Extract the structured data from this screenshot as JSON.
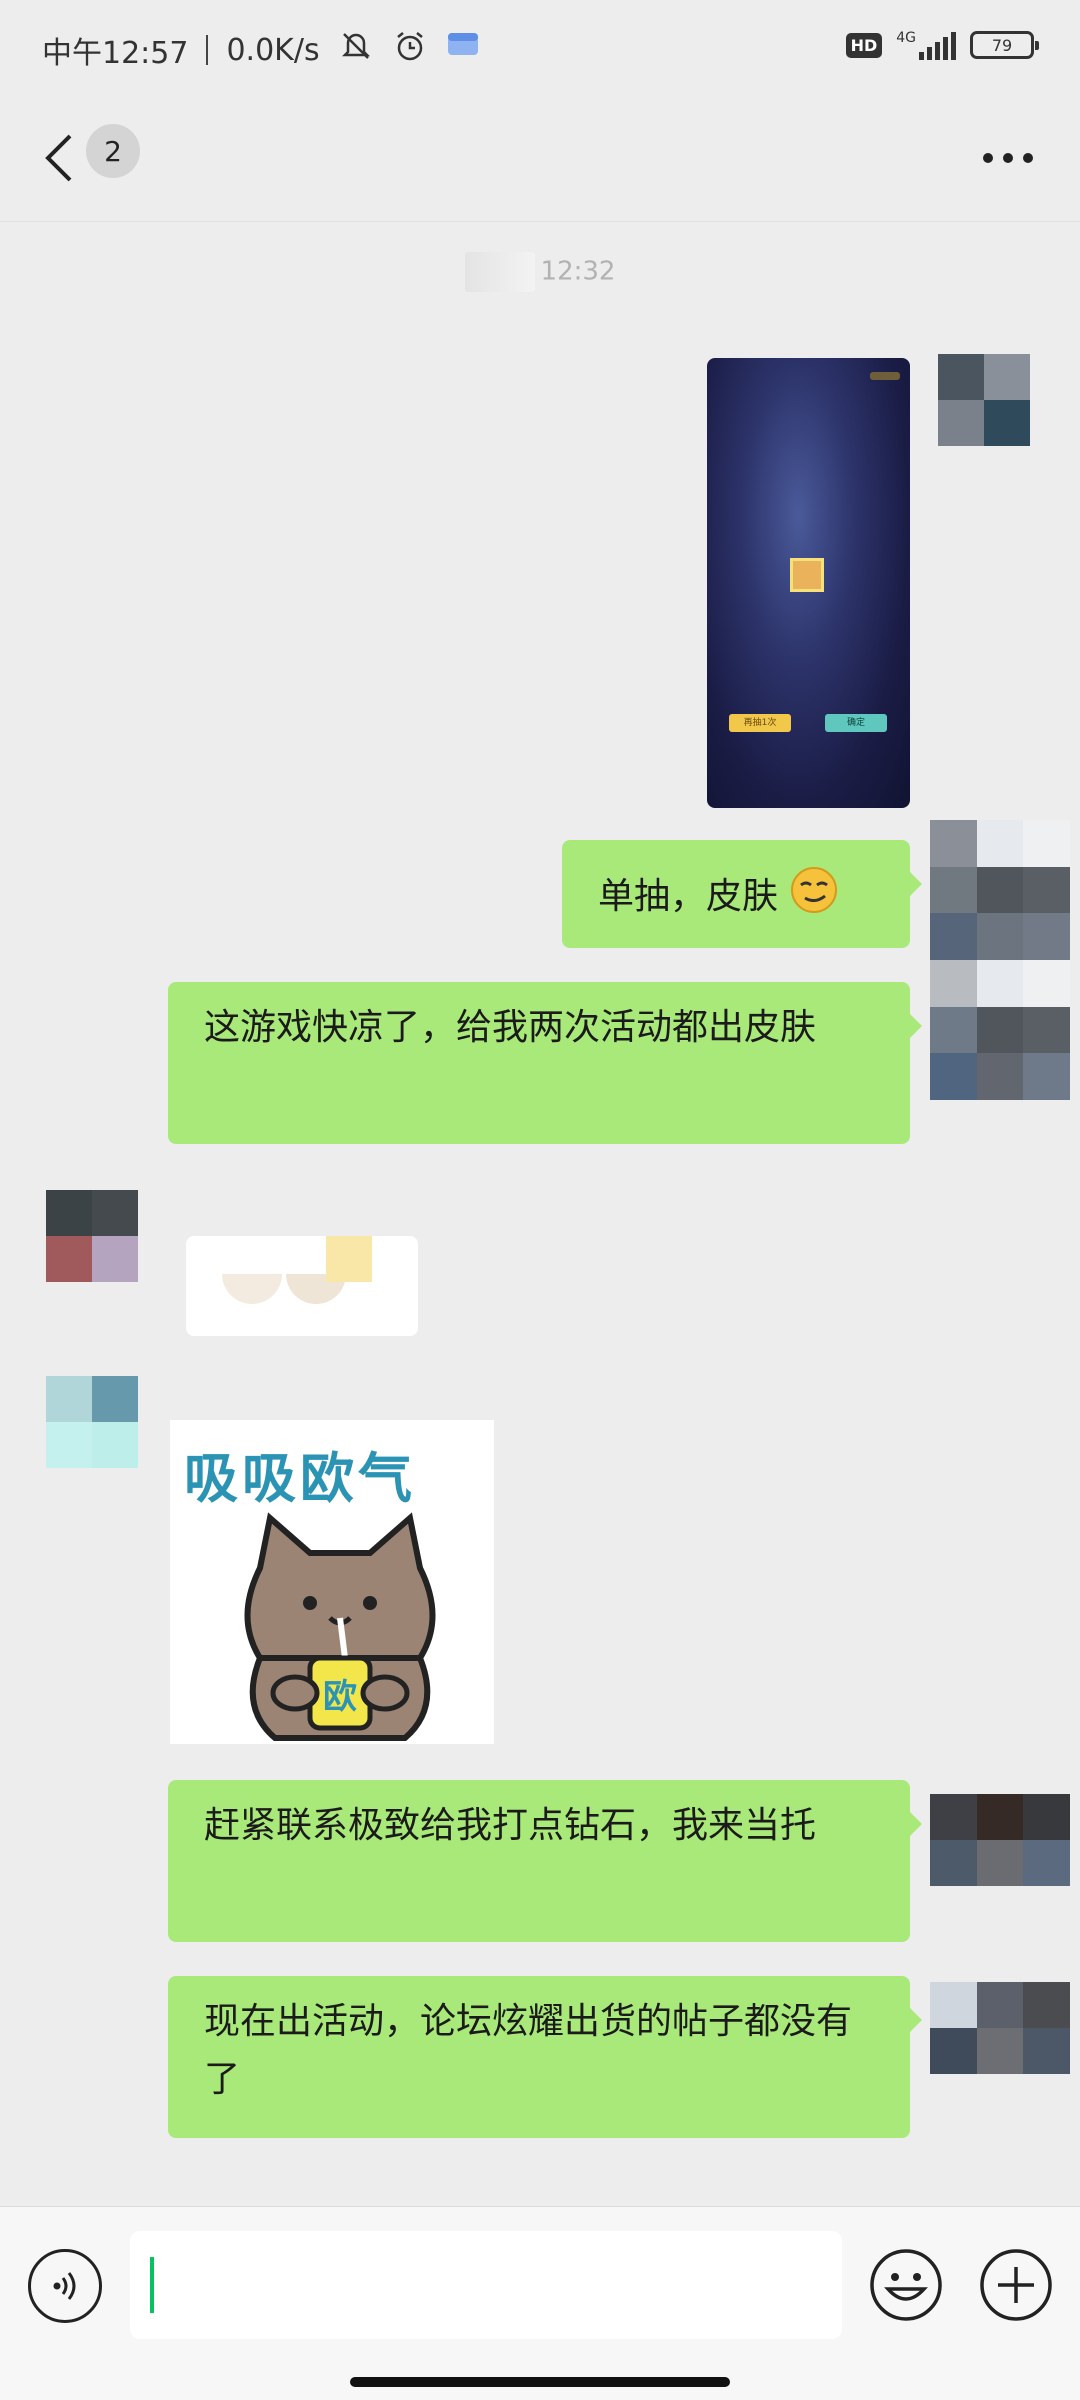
{
  "status_bar": {
    "time": "中午12:57",
    "net_speed": "0.0K/s",
    "hd": "HD",
    "signal": "4G",
    "battery": "79"
  },
  "header": {
    "unread_count": "2"
  },
  "messages": {
    "timestamp": "12:32",
    "msg2": "单抽，皮肤",
    "msg3": "这游戏快凉了，给我两次活动都出皮肤",
    "sticker_text": "吸吸欧气",
    "sticker_badge": "欧",
    "msg5": "赶紧联系极致给我打点钻石，我来当托",
    "msg6": "现在出活动，论坛炫耀出货的帖子都没有了"
  },
  "game_screenshot": {
    "btn1": "再抽1次",
    "btn2": "确定"
  },
  "colors": {
    "bubble": "#a9e97a",
    "background": "#ededed",
    "caret": "#07c160"
  }
}
